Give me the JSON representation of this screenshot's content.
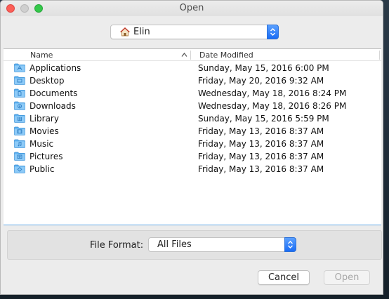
{
  "window": {
    "title": "Open"
  },
  "location": {
    "label": "Elin",
    "icon": "home-icon"
  },
  "columns": {
    "name": "Name",
    "date_modified": "Date Modified"
  },
  "files": [
    {
      "name": "Applications",
      "date": "Sunday, May 15, 2016 6:00 PM",
      "icon": "applications-folder-icon"
    },
    {
      "name": "Desktop",
      "date": "Friday, May 20, 2016 9:32 AM",
      "icon": "desktop-folder-icon"
    },
    {
      "name": "Documents",
      "date": "Wednesday, May 18, 2016 8:24 PM",
      "icon": "documents-folder-icon"
    },
    {
      "name": "Downloads",
      "date": "Wednesday, May 18, 2016 8:26 PM",
      "icon": "downloads-folder-icon"
    },
    {
      "name": "Library",
      "date": "Sunday, May 15, 2016 5:59 PM",
      "icon": "library-folder-icon"
    },
    {
      "name": "Movies",
      "date": "Friday, May 13, 2016 8:37 AM",
      "icon": "movies-folder-icon"
    },
    {
      "name": "Music",
      "date": "Friday, May 13, 2016 8:37 AM",
      "icon": "music-folder-icon"
    },
    {
      "name": "Pictures",
      "date": "Friday, May 13, 2016 8:37 AM",
      "icon": "pictures-folder-icon"
    },
    {
      "name": "Public",
      "date": "Friday, May 13, 2016 8:37 AM",
      "icon": "public-folder-icon"
    }
  ],
  "format": {
    "label": "File Format:",
    "value": "All Files"
  },
  "buttons": {
    "cancel": "Cancel",
    "open": "Open"
  },
  "colors": {
    "accent": "#1a6cf5",
    "folder": "#5db1f0",
    "selection_border": "#5fa8e6"
  }
}
